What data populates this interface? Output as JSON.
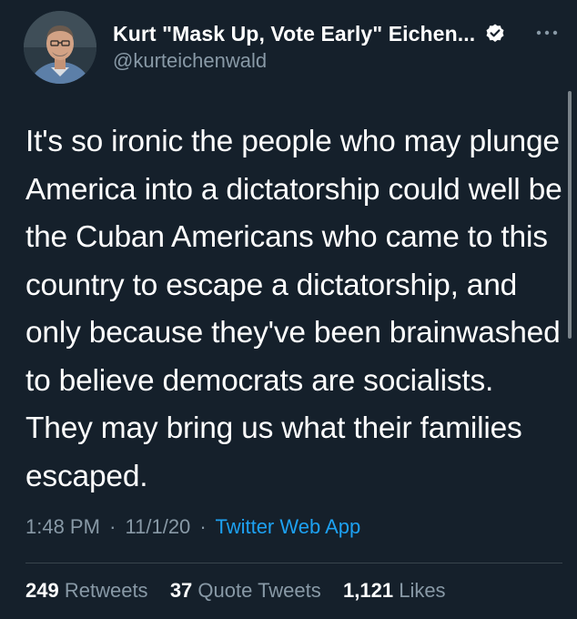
{
  "author": {
    "display_name": "Kurt \"Mask Up, Vote Early\" Eichen...",
    "handle": "@kurteichenwald",
    "verified": true
  },
  "tweet": {
    "text": "It's so ironic the people who may plunge America into a dictatorship could well be the Cuban Americans who came to this country to escape a dictatorship, and only because they've been brainwashed to believe democrats are socialists. They may bring us what their families escaped.",
    "time": "1:48 PM",
    "date": "11/1/20",
    "source": "Twitter Web App",
    "separator": "·"
  },
  "stats": {
    "retweets_count": "249",
    "retweets_label": "Retweets",
    "quotes_count": "37",
    "quotes_label": "Quote Tweets",
    "likes_count": "1,121",
    "likes_label": "Likes"
  },
  "icons": {
    "verified": "verified-badge-icon",
    "more": "more-options-icon"
  },
  "colors": {
    "background": "#15202b",
    "secondary_text": "#8899a6",
    "link": "#1da1f2",
    "divider": "#38444d"
  }
}
